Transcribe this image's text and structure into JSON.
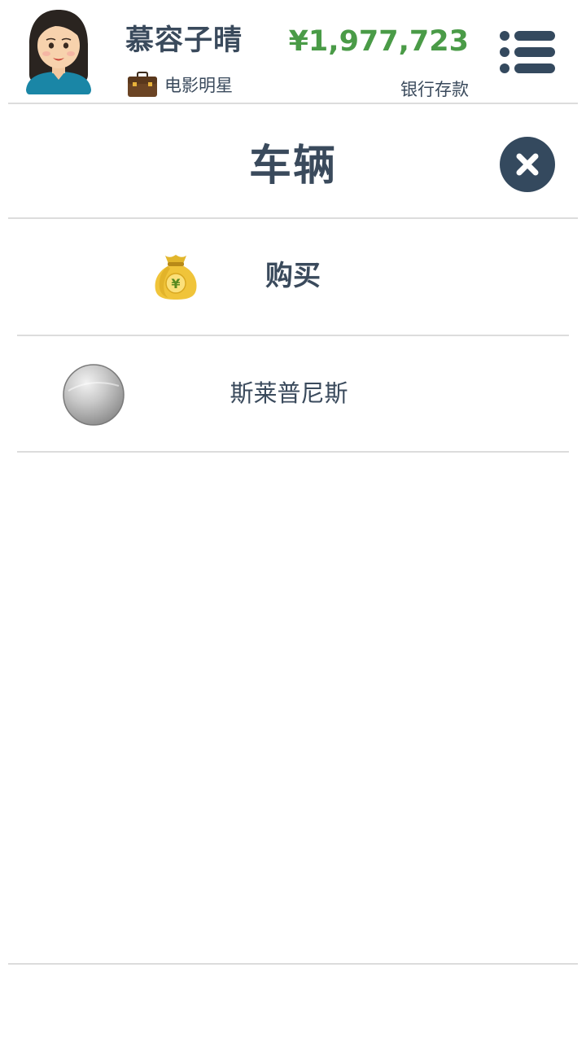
{
  "header": {
    "player_name": "慕容子晴",
    "job_title": "电影明星",
    "bank_amount": "¥1,977,723",
    "bank_label": "银行存款",
    "icons": {
      "avatar": "female-avatar-icon",
      "job": "briefcase-icon",
      "menu": "menu-list-icon"
    },
    "colors": {
      "bank_amount": "#4a9b47",
      "text": "#3a4a5c"
    }
  },
  "page": {
    "title": "车辆",
    "close_icon": "close-icon"
  },
  "actions": {
    "buy_label": "购买",
    "buy_icon": "money-bag-icon"
  },
  "vehicles": [
    {
      "name": "斯莱普尼斯",
      "swatch_icon": "silver-circle-icon",
      "swatch_color": "#b5b5b5"
    }
  ]
}
